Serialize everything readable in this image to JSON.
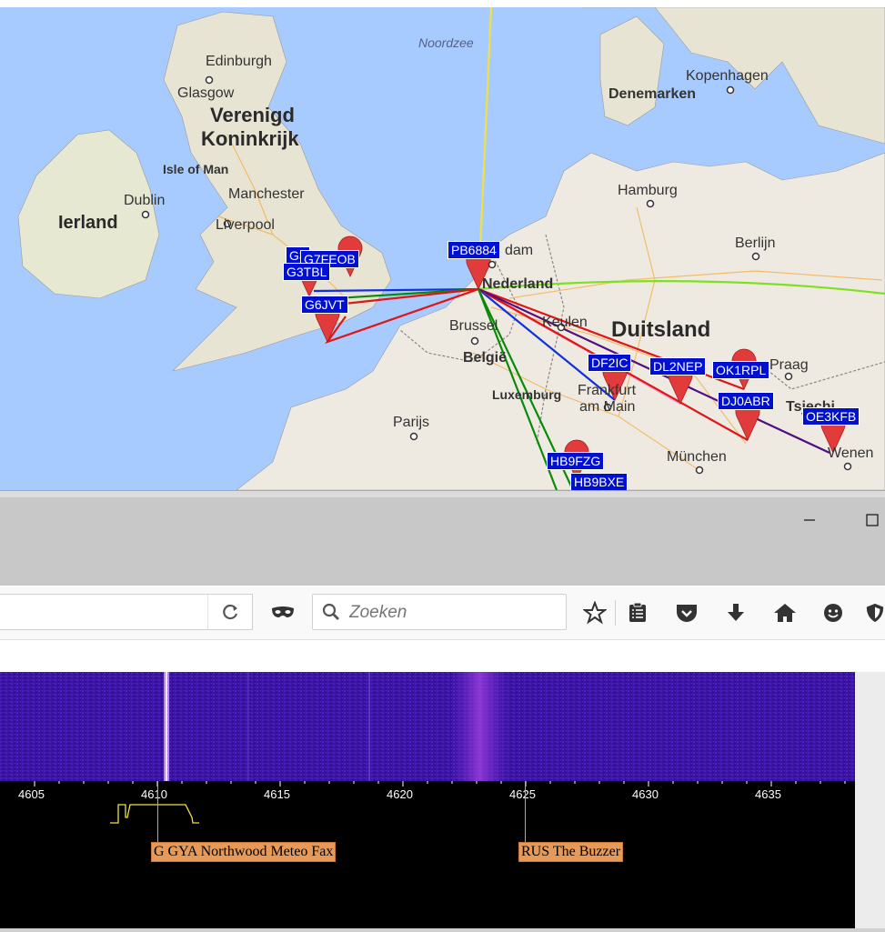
{
  "map": {
    "sea": "Noordzee",
    "countries": {
      "uk_line1": "Verenigd",
      "uk_line2": "Koninkrijk",
      "ireland": "Ierland",
      "netherlands": "Nederland",
      "belgium": "België",
      "germany": "Duitsland",
      "denmark": "Denemarken",
      "czech": "Tsjechi",
      "isle_of_man": "Isle of Man",
      "luxembourg": "Luxemburg"
    },
    "cities": {
      "edinburgh": "Edinburgh",
      "glasgow": "Glasgow",
      "dublin": "Dublin",
      "manchester": "Manchester",
      "liverpool": "Liverpool",
      "kopenhagen": "Kopenhagen",
      "hamburg": "Hamburg",
      "berlijn": "Berlijn",
      "amsterdam_partial": "dam",
      "brussel": "Brussel",
      "keulen": "Keulen",
      "frankfurt_line1": "Frankfurt",
      "frankfurt_line2": "am Main",
      "parijs": "Parijs",
      "praag": "Praag",
      "munchen": "München",
      "wenen": "Wenen"
    },
    "callsigns": {
      "pb6884": "PB6884",
      "g_partial": "G3",
      "g7feob": "G7FEOB",
      "g3tbl": "G3TBL",
      "g6jvt": "G6JVT",
      "df2ic": "DF2IC",
      "dl2nep": "DL2NEP",
      "ok1rpl": "OK1RPL",
      "dj0abr": "DJ0ABR",
      "oe3kfb": "OE3KFB",
      "hb9fzg": "HB9FZG",
      "hb9bxe": "HB9BXE"
    },
    "colors": {
      "water": "#a8cbff",
      "land": "#efeae1",
      "marker": "#e23b3b",
      "label_bg": "#0010d0"
    }
  },
  "window": {
    "minimize_icon": "minimize-icon",
    "maximize_icon": "maximize-icon"
  },
  "toolbar": {
    "search_placeholder": "Zoeken",
    "icons": [
      "reload-icon",
      "private-mask-icon",
      "search-icon",
      "bookmark-star-icon",
      "reader-list-icon",
      "pocket-icon",
      "download-icon",
      "home-icon",
      "smiley-icon",
      "shield-icon"
    ]
  },
  "spectrum": {
    "ticks": [
      "4605",
      "4610",
      "4615",
      "4620",
      "4625",
      "4630",
      "4635"
    ],
    "stations": [
      {
        "label": "G GYA Northwood Meteo Fax",
        "freq": 4610
      },
      {
        "label": "RUS The Buzzer",
        "freq": 4625
      }
    ],
    "colors": {
      "waterfall": "#3a12a8",
      "scale_bg": "#000000",
      "station_bg": "#e59a5a",
      "filter_trace": "#f0e040"
    }
  }
}
